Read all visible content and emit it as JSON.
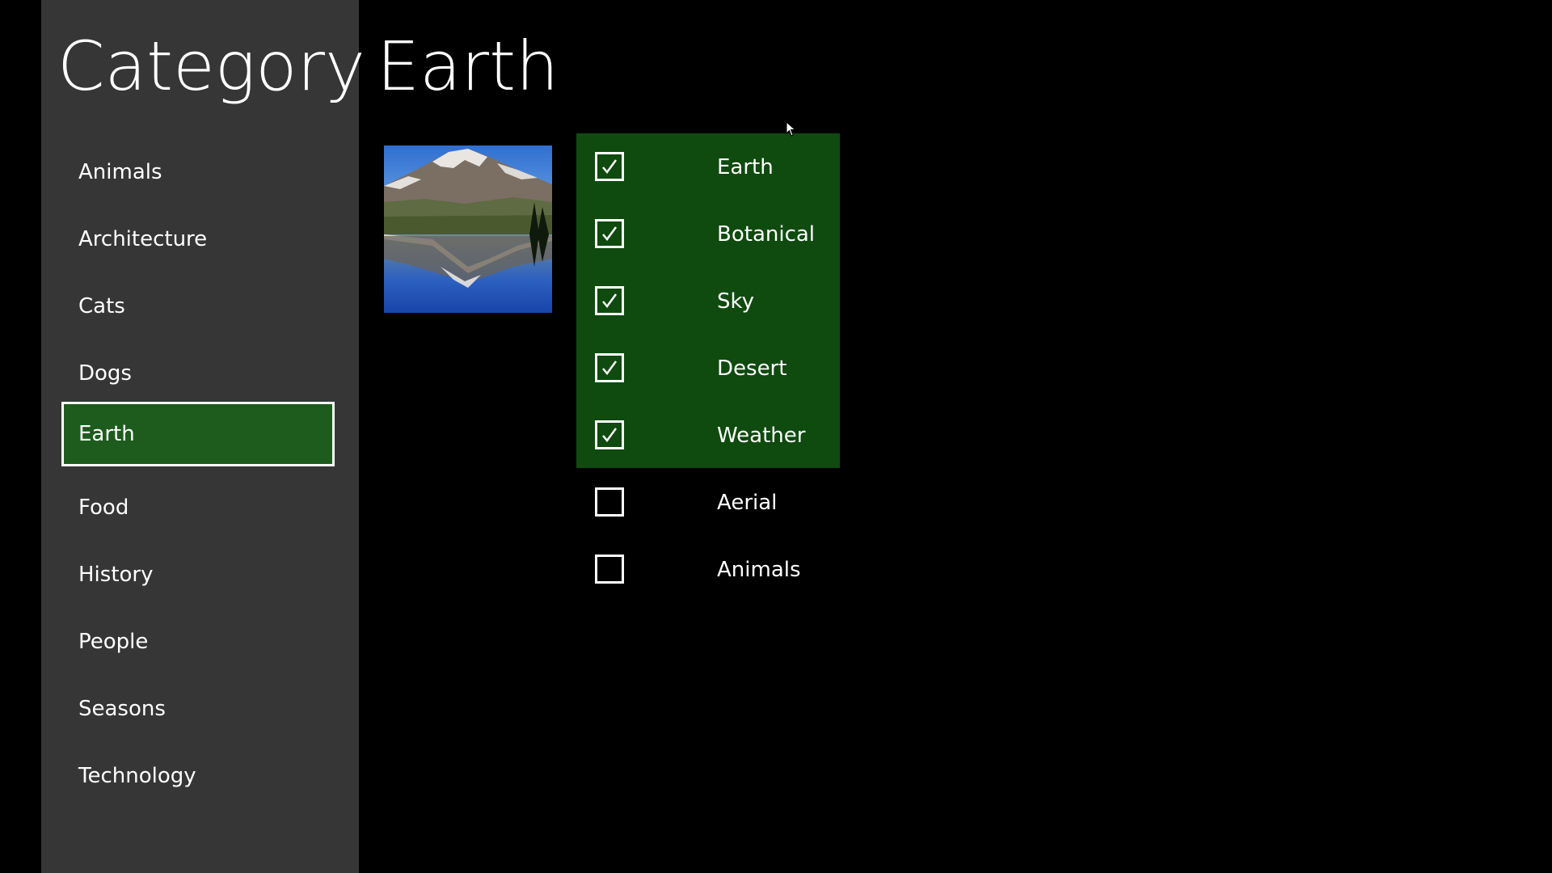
{
  "sidebar": {
    "title": "Category",
    "items": [
      {
        "label": "Animals",
        "selected": false
      },
      {
        "label": "Architecture",
        "selected": false
      },
      {
        "label": "Cats",
        "selected": false
      },
      {
        "label": "Dogs",
        "selected": false
      },
      {
        "label": "Earth",
        "selected": true
      },
      {
        "label": "Food",
        "selected": false
      },
      {
        "label": "History",
        "selected": false
      },
      {
        "label": "People",
        "selected": false
      },
      {
        "label": "Seasons",
        "selected": false
      },
      {
        "label": "Technology",
        "selected": false
      }
    ]
  },
  "main": {
    "title": "Earth",
    "thumbnail": {
      "icon": "mountain-lake-photo"
    },
    "tags": [
      {
        "label": "Earth",
        "checked": true
      },
      {
        "label": "Botanical",
        "checked": true
      },
      {
        "label": "Sky",
        "checked": true
      },
      {
        "label": "Desert",
        "checked": true
      },
      {
        "label": "Weather",
        "checked": true
      },
      {
        "label": "Aerial",
        "checked": false
      },
      {
        "label": "Animals",
        "checked": false
      }
    ]
  },
  "colors": {
    "background": "#000000",
    "sidebar": "#363636",
    "selected_category": "#1e5c1e",
    "checked_panel": "#0f4a0f",
    "text": "#ffffff"
  }
}
